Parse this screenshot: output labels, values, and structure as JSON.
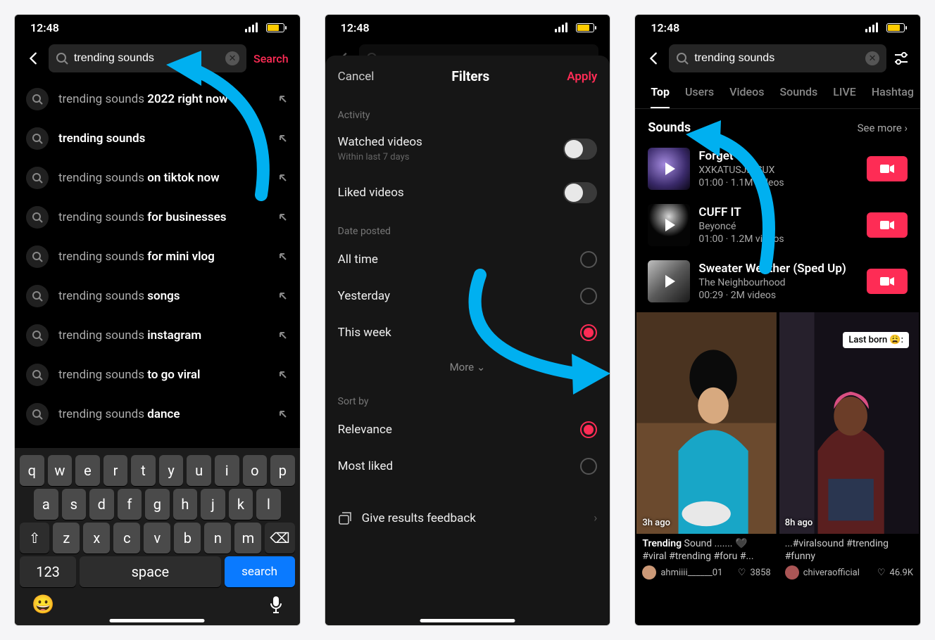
{
  "status": {
    "time": "12:48"
  },
  "p1": {
    "query": "trending sounds",
    "search_label": "Search",
    "suggestions": [
      {
        "prefix": "trending sounds ",
        "bold": "2022 right now"
      },
      {
        "prefix": "",
        "bold": "trending sounds"
      },
      {
        "prefix": "trending sounds ",
        "bold": "on tiktok now"
      },
      {
        "prefix": "trending sounds ",
        "bold": "for businesses"
      },
      {
        "prefix": "trending sounds ",
        "bold": "for mini vlog"
      },
      {
        "prefix": "trending sounds ",
        "bold": "songs"
      },
      {
        "prefix": "trending sounds ",
        "bold": "instagram"
      },
      {
        "prefix": "trending sounds ",
        "bold": "to go viral"
      },
      {
        "prefix": "trending sounds ",
        "bold": "dance"
      }
    ],
    "keyboard": {
      "r1": [
        "q",
        "w",
        "e",
        "r",
        "t",
        "y",
        "u",
        "i",
        "o",
        "p"
      ],
      "r2": [
        "a",
        "s",
        "d",
        "f",
        "g",
        "h",
        "j",
        "k",
        "l"
      ],
      "r3": [
        "z",
        "x",
        "c",
        "v",
        "b",
        "n",
        "m"
      ],
      "num": "123",
      "space": "space",
      "search": "search"
    }
  },
  "p2": {
    "cancel": "Cancel",
    "title": "Filters",
    "apply": "Apply",
    "activity_lbl": "Activity",
    "watched": "Watched videos",
    "watched_sub": "Within last 7 days",
    "liked": "Liked videos",
    "date_lbl": "Date posted",
    "all_time": "All time",
    "yesterday": "Yesterday",
    "this_week": "This week",
    "more": "More",
    "sort_lbl": "Sort by",
    "relevance": "Relevance",
    "most_liked": "Most liked",
    "feedback": "Give results feedback"
  },
  "p3": {
    "query": "trending sounds",
    "tabs": [
      "Top",
      "Users",
      "Videos",
      "Sounds",
      "LIVE",
      "Hashtag"
    ],
    "section": "Sounds",
    "see_more": "See more",
    "sounds": [
      {
        "title": "Forget",
        "artist": "XXKATUSJINSUX",
        "meta": "01:00 · 1.1M videos"
      },
      {
        "title": "CUFF IT",
        "artist": "Beyoncé",
        "meta": "01:00 · 1.2M videos"
      },
      {
        "title": "Sweater Weather (Sped Up)",
        "artist": "The Neighbourhood",
        "meta": "00:29 · 2M videos"
      }
    ],
    "cards": [
      {
        "age": "3h ago",
        "cap_b": "Trending",
        "cap_rest": " Sound ....... 🖤 #viral #trending #foru #...",
        "user": "ahmiiii______01",
        "likes": "3858"
      },
      {
        "age": "8h ago",
        "label": "Last born 😩:",
        "cap_b": "",
        "cap_rest": "...#viralsound #trending #funny",
        "user": "chiveraofficial",
        "likes": "46.9K",
        "cap_b2": "#trending"
      }
    ]
  }
}
